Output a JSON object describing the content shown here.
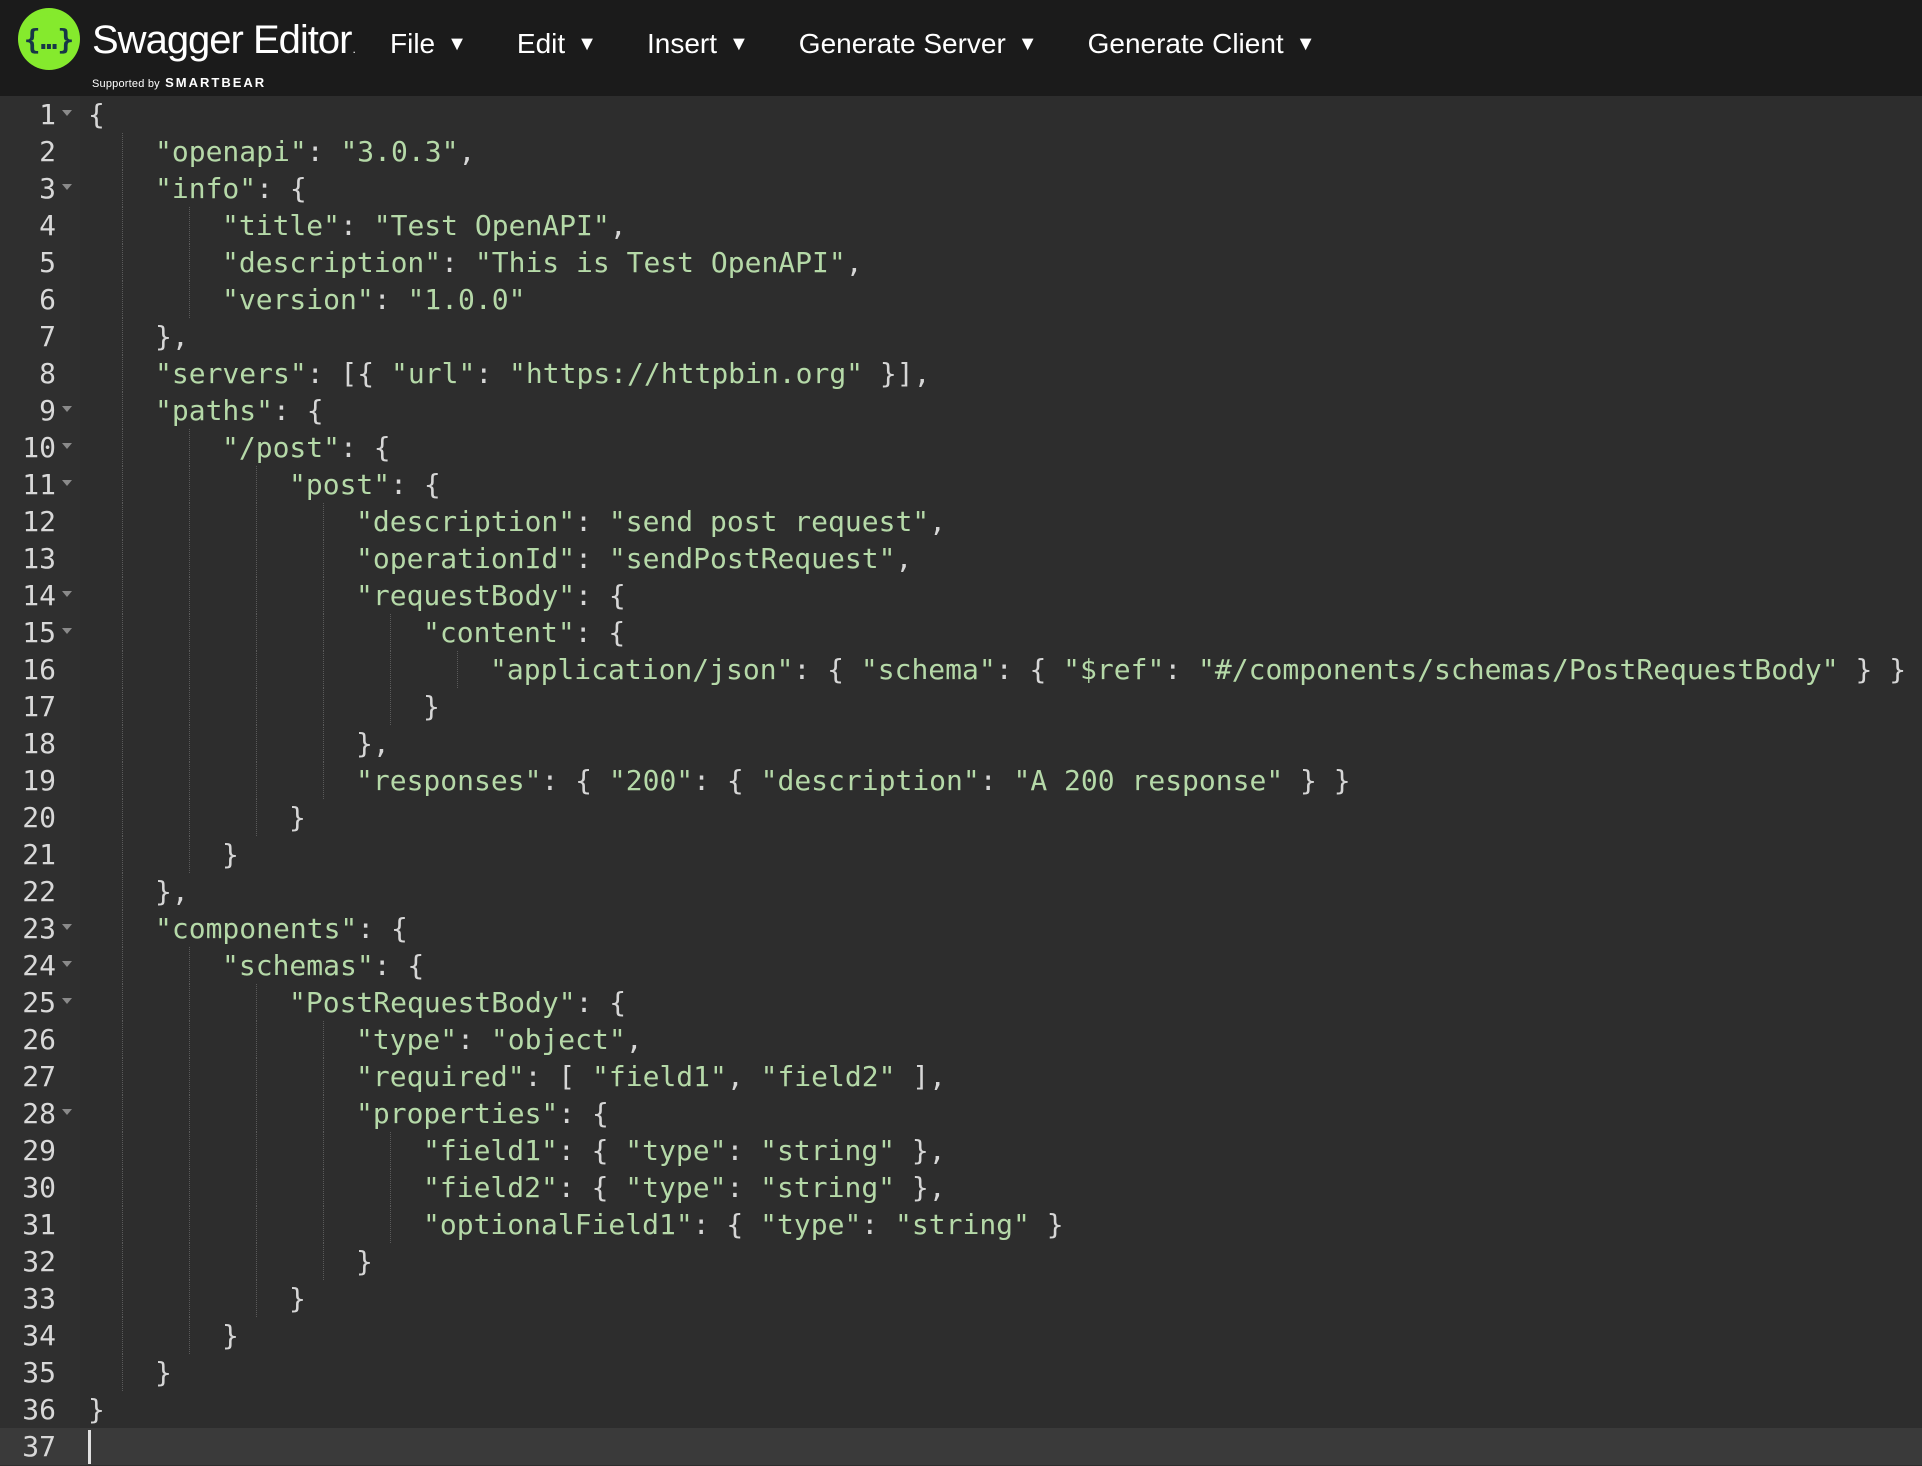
{
  "app": {
    "title": "Swagger Editor",
    "tm": ".",
    "supported_by": "Supported by",
    "brand": "SMARTBEAR"
  },
  "menu": [
    {
      "label": "File",
      "caret": "▼"
    },
    {
      "label": "Edit",
      "caret": "▼"
    },
    {
      "label": "Insert",
      "caret": "▼"
    },
    {
      "label": "Generate Server",
      "caret": "▼"
    },
    {
      "label": "Generate Client",
      "caret": "▼"
    }
  ],
  "colors": {
    "topbar": "#1b1b1b",
    "editor_bg": "#2d2d2d",
    "logo_green": "#85ea2d",
    "string": "#b5d9a8"
  },
  "editor": {
    "lines": [
      {
        "n": "1",
        "fold": true,
        "indent": 0,
        "text": "{"
      },
      {
        "n": "2",
        "fold": false,
        "indent": 1,
        "text": "\"openapi\": \"3.0.3\","
      },
      {
        "n": "3",
        "fold": true,
        "indent": 1,
        "text": "\"info\": {"
      },
      {
        "n": "4",
        "fold": false,
        "indent": 2,
        "text": "\"title\": \"Test OpenAPI\","
      },
      {
        "n": "5",
        "fold": false,
        "indent": 2,
        "text": "\"description\": \"This is Test OpenAPI\","
      },
      {
        "n": "6",
        "fold": false,
        "indent": 2,
        "text": "\"version\": \"1.0.0\""
      },
      {
        "n": "7",
        "fold": false,
        "indent": 1,
        "text": "},"
      },
      {
        "n": "8",
        "fold": false,
        "indent": 1,
        "text": "\"servers\": [{ \"url\": \"https://httpbin.org\" }],"
      },
      {
        "n": "9",
        "fold": true,
        "indent": 1,
        "text": "\"paths\": {"
      },
      {
        "n": "10",
        "fold": true,
        "indent": 2,
        "text": "\"/post\": {"
      },
      {
        "n": "11",
        "fold": true,
        "indent": 3,
        "text": "\"post\": {"
      },
      {
        "n": "12",
        "fold": false,
        "indent": 4,
        "text": "\"description\": \"send post request\","
      },
      {
        "n": "13",
        "fold": false,
        "indent": 4,
        "text": "\"operationId\": \"sendPostRequest\","
      },
      {
        "n": "14",
        "fold": true,
        "indent": 4,
        "text": "\"requestBody\": {"
      },
      {
        "n": "15",
        "fold": true,
        "indent": 5,
        "text": "\"content\": {"
      },
      {
        "n": "16",
        "fold": false,
        "indent": 6,
        "text": "\"application/json\": { \"schema\": { \"$ref\": \"#/components/schemas/PostRequestBody\" } }"
      },
      {
        "n": "17",
        "fold": false,
        "indent": 5,
        "text": "}"
      },
      {
        "n": "18",
        "fold": false,
        "indent": 4,
        "text": "},"
      },
      {
        "n": "19",
        "fold": false,
        "indent": 4,
        "text": "\"responses\": { \"200\": { \"description\": \"A 200 response\" } }"
      },
      {
        "n": "20",
        "fold": false,
        "indent": 3,
        "text": "}"
      },
      {
        "n": "21",
        "fold": false,
        "indent": 2,
        "text": "}"
      },
      {
        "n": "22",
        "fold": false,
        "indent": 1,
        "text": "},"
      },
      {
        "n": "23",
        "fold": true,
        "indent": 1,
        "text": "\"components\": {"
      },
      {
        "n": "24",
        "fold": true,
        "indent": 2,
        "text": "\"schemas\": {"
      },
      {
        "n": "25",
        "fold": true,
        "indent": 3,
        "text": "\"PostRequestBody\": {"
      },
      {
        "n": "26",
        "fold": false,
        "indent": 4,
        "text": "\"type\": \"object\","
      },
      {
        "n": "27",
        "fold": false,
        "indent": 4,
        "text": "\"required\": [ \"field1\", \"field2\" ],"
      },
      {
        "n": "28",
        "fold": true,
        "indent": 4,
        "text": "\"properties\": {"
      },
      {
        "n": "29",
        "fold": false,
        "indent": 5,
        "text": "\"field1\": { \"type\": \"string\" },"
      },
      {
        "n": "30",
        "fold": false,
        "indent": 5,
        "text": "\"field2\": { \"type\": \"string\" },"
      },
      {
        "n": "31",
        "fold": false,
        "indent": 5,
        "text": "\"optionalField1\": { \"type\": \"string\" }"
      },
      {
        "n": "32",
        "fold": false,
        "indent": 4,
        "text": "}"
      },
      {
        "n": "33",
        "fold": false,
        "indent": 3,
        "text": "}"
      },
      {
        "n": "34",
        "fold": false,
        "indent": 2,
        "text": "}"
      },
      {
        "n": "35",
        "fold": false,
        "indent": 1,
        "text": "}"
      },
      {
        "n": "36",
        "fold": false,
        "indent": 0,
        "text": "}"
      },
      {
        "n": "37",
        "fold": false,
        "indent": 0,
        "text": "",
        "active": true
      }
    ]
  }
}
